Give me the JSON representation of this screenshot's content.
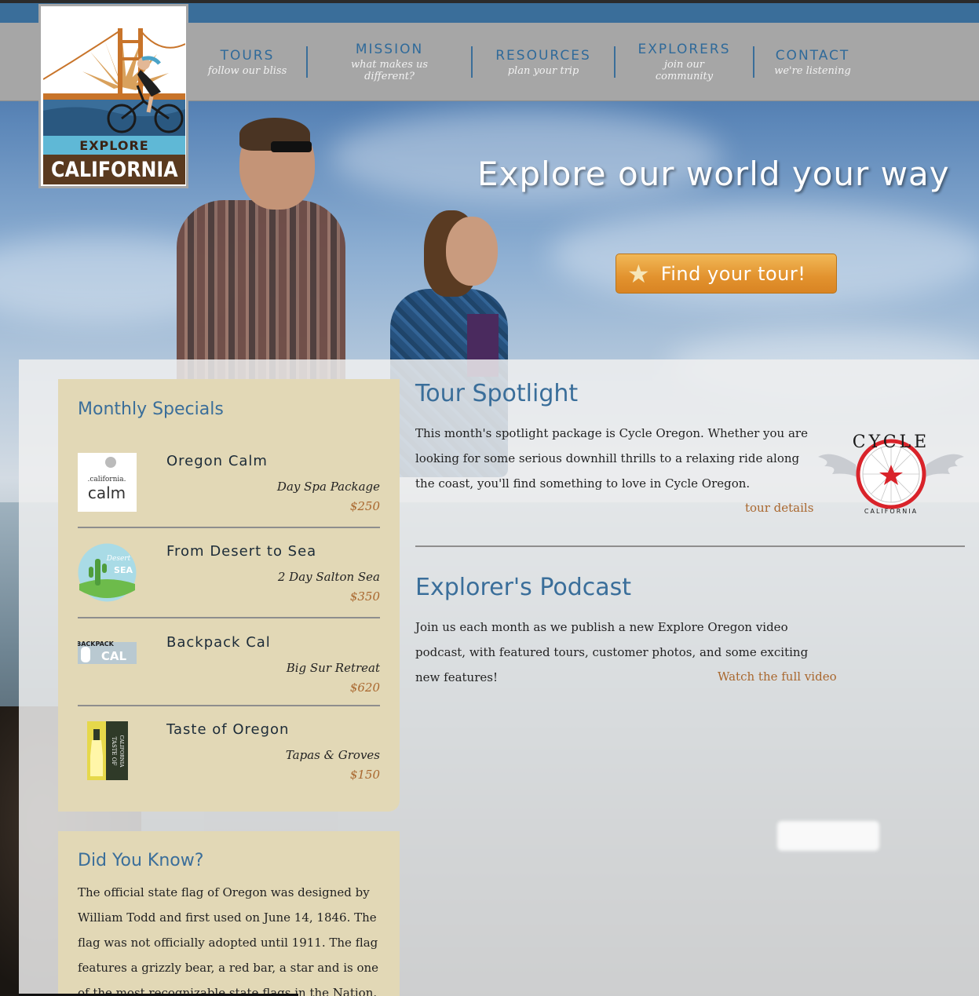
{
  "nav": {
    "items": [
      {
        "title": "TOURS",
        "sub": "follow our bliss"
      },
      {
        "title": "MISSION",
        "sub": "what makes us different?"
      },
      {
        "title": "RESOURCES",
        "sub": "plan your trip"
      },
      {
        "title": "EXPLORERS",
        "sub": "join our community"
      },
      {
        "title": "CONTACT",
        "sub": "we're listening"
      }
    ]
  },
  "logo": {
    "line1": "EXPLORE",
    "line2": "CALIFORNIA"
  },
  "hero": {
    "headline": "Explore our world your way",
    "cta_label": "Find your tour!"
  },
  "specials": {
    "title": "Monthly Specials",
    "items": [
      {
        "name": "Oregon Calm",
        "desc": "Day Spa Package",
        "price": "$250",
        "thumb_text_top": ".california.",
        "thumb_text_main": "calm"
      },
      {
        "name": "From Desert to Sea",
        "desc": "2 Day Salton Sea",
        "price": "$350",
        "thumb_text_top": "Desert",
        "thumb_text_main": "SEA"
      },
      {
        "name": "Backpack Cal",
        "desc": "Big Sur Retreat",
        "price": "$620",
        "thumb_text_top": "BACKPACK",
        "thumb_text_main": "CAL"
      },
      {
        "name": "Taste of Oregon",
        "desc": "Tapas & Groves",
        "price": "$150",
        "thumb_text_top": "TASTE OF",
        "thumb_text_main": "CALIFORNIA"
      }
    ]
  },
  "didyouknow": {
    "title": "Did You Know?",
    "text": "The official state flag of Oregon was designed by William Todd and first used on June 14, 1846. The flag was not officially adopted until 1911. The flag features a grizzly bear, a red bar, a star and is one of the most recognizable state flags in the Nation."
  },
  "spotlight": {
    "title": "Tour Spotlight",
    "text": "This month's spotlight package is Cycle Oregon. Whether you are looking for some serious downhill thrills to a relaxing ride along the coast, you'll find something to love in Cycle Oregon.",
    "link": "tour details",
    "logo_top": "CYCLE",
    "logo_bottom": "CALIFORNIA"
  },
  "podcast": {
    "title": "Explorer's Podcast",
    "text": "Join us each month as we publish a new Explore Oregon video podcast, with featured tours, customer photos, and some exciting new features!",
    "link": "Watch the full video"
  },
  "colors": {
    "accent_blue": "#3a6e9a",
    "link_brown": "#a9672e",
    "panel_tan": "#e2d8b6",
    "cta_orange": "#e2922e"
  }
}
